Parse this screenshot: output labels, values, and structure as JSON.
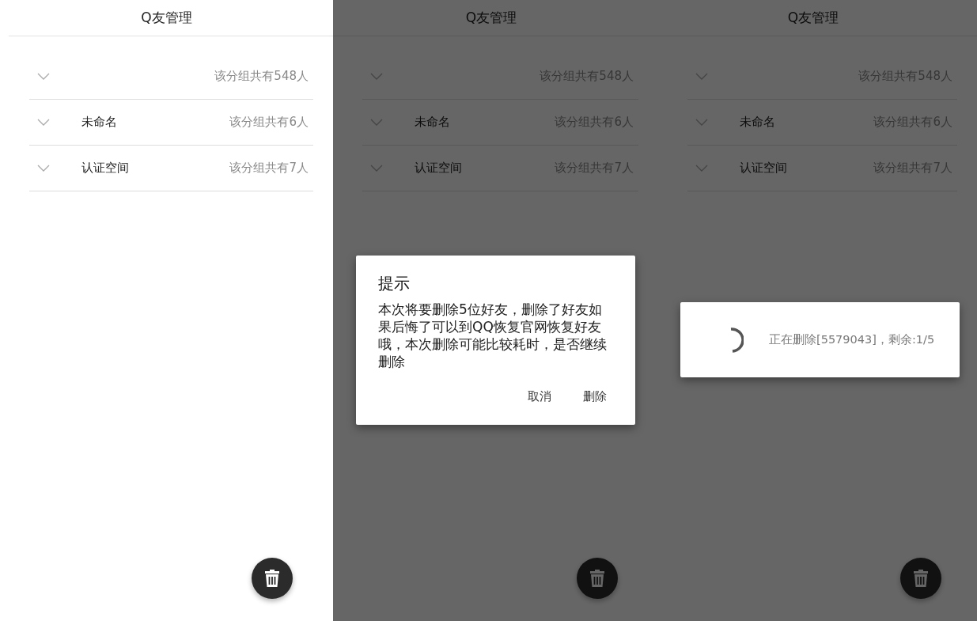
{
  "screens": [
    {
      "title": "Q友管理",
      "dimmed": false,
      "groups": [
        {
          "count": "该分组共有548人"
        },
        {
          "name": "未命名",
          "count": "该分组共有6人"
        },
        {
          "name": "认证空间",
          "count": "该分组共有7人"
        }
      ]
    },
    {
      "title": "Q友管理",
      "dimmed": true,
      "groups": [
        {
          "count": "该分组共有548人"
        },
        {
          "name": "未命名",
          "count": "该分组共有6人"
        },
        {
          "name": "认证空间",
          "count": "该分组共有7人"
        }
      ],
      "dialog": {
        "kind": "confirm",
        "title": "提示",
        "message": "本次将要删除5位好友，删除了好友如果后悔了可以到QQ恢复官网恢复好友哦，本次删除可能比较耗时，是否继续删除",
        "buttons": [
          "取消",
          "删除"
        ]
      }
    },
    {
      "title": "Q友管理",
      "dimmed": true,
      "groups": [
        {
          "count": "该分组共有548人"
        },
        {
          "name": "未命名",
          "count": "该分组共有6人"
        },
        {
          "name": "认证空间",
          "count": "该分组共有7人"
        }
      ],
      "dialog": {
        "kind": "progress",
        "message": "正在删除[5579043]，剩余:1/5"
      }
    }
  ]
}
